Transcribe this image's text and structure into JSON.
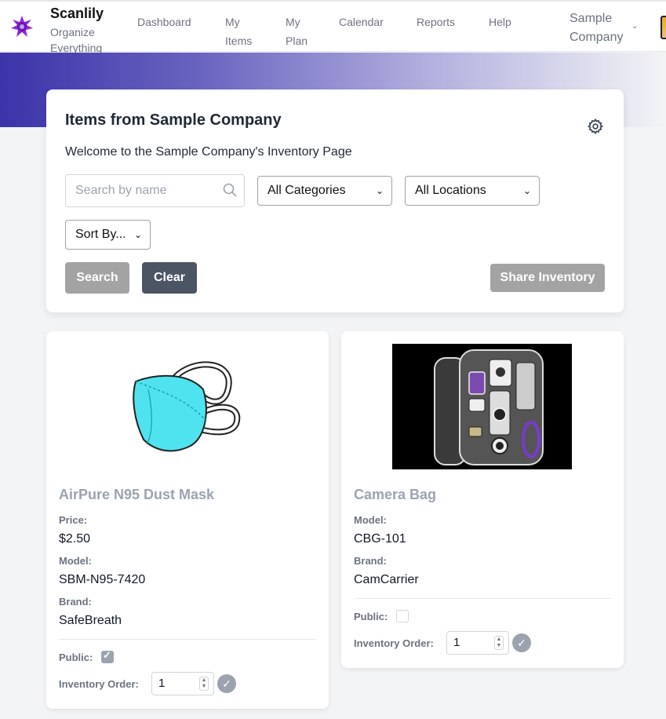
{
  "nav": {
    "brand": "Scanlily",
    "tagline": "Organize Everything",
    "links": [
      "Dashboard",
      "My Items",
      "My Plan",
      "Calendar",
      "Reports",
      "Help"
    ],
    "company": "Sample Company"
  },
  "panel": {
    "title": "Items from Sample Company",
    "welcome": "Welcome to the Sample Company's Inventory Page",
    "search_placeholder": "Search by name",
    "category_select": "All Categories",
    "location_select": "All Locations",
    "sort_select": "Sort By...",
    "search_btn": "Search",
    "clear_btn": "Clear",
    "share_btn": "Share Inventory"
  },
  "labels": {
    "price": "Price:",
    "model": "Model:",
    "brand": "Brand:",
    "public": "Public:",
    "inventory_order": "Inventory Order:"
  },
  "items": [
    {
      "name": "AirPure N95 Dust Mask",
      "price": "$2.50",
      "model": "SBM-N95-7420",
      "brand": "SafeBreath",
      "public": true,
      "order": "1"
    },
    {
      "name": "Camera Bag",
      "model": "CBG-101",
      "brand": "CamCarrier",
      "public": false,
      "order": "1"
    }
  ],
  "colors": {
    "accent_purple": "#3b33a8",
    "mask_teal": "#4fe3ef",
    "button_dark": "#4b5563",
    "button_muted": "#a3a3a3"
  }
}
